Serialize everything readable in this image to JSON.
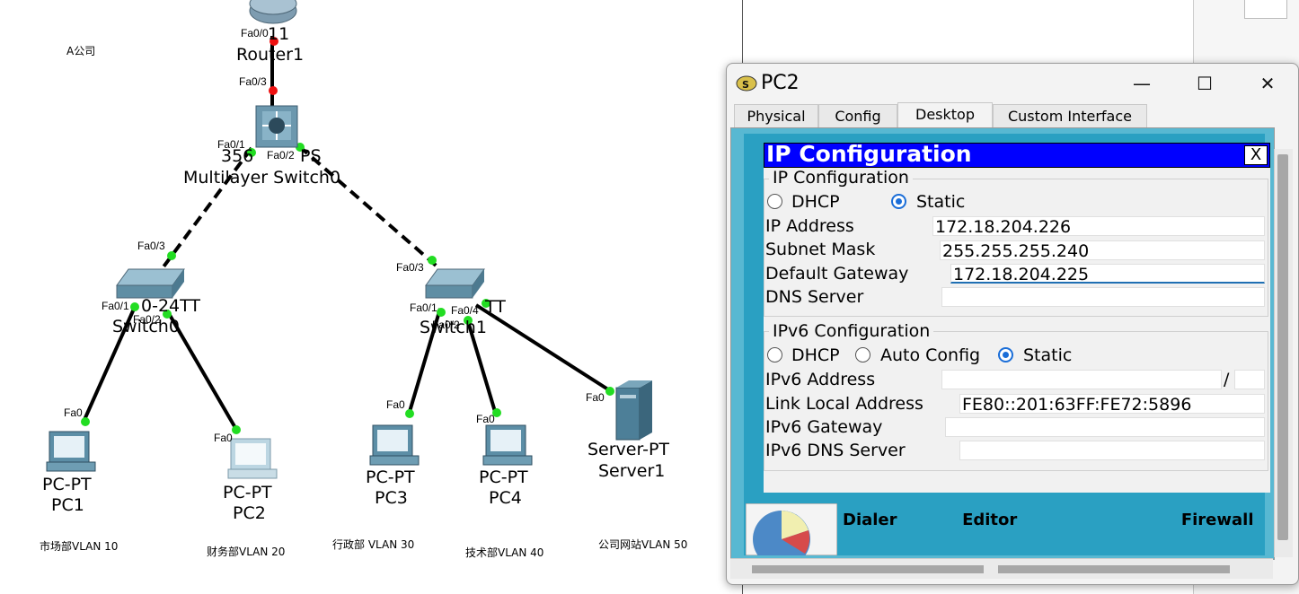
{
  "topology": {
    "company_label": "A公司",
    "router": {
      "model_fragment": "11",
      "name": "Router1"
    },
    "multilayer_switch": {
      "model_fragment": "356",
      "model_suffix": "PS",
      "name": "Multilayer Switch0"
    },
    "switch0": {
      "model_fragment": "0-24TT",
      "name": "Switch0"
    },
    "switch1": {
      "model_fragment": "TT",
      "name": "Switch1"
    },
    "ports": {
      "r_fa00": "Fa0/0",
      "r_fa03": "Fa0/3",
      "ms_fa01": "Fa0/1",
      "ms_fa02": "Fa0/2",
      "s0_fa03": "Fa0/3",
      "s0_fa01": "Fa0/1",
      "s0_fa02": "Fa0/2",
      "s1_fa03": "Fa0/3",
      "s1_fa01": "Fa0/1",
      "s1_fa04": "Fa0/4",
      "s1_fa02": "Fa0/2",
      "pc1_fa0": "Fa0",
      "pc2_fa0": "Fa0",
      "pc3_fa0": "Fa0",
      "pc4_fa0": "Fa0",
      "srv_fa0": "Fa0"
    },
    "devices": [
      {
        "type": "PC-PT",
        "name": "PC1",
        "vlan": "市场部VLAN 10"
      },
      {
        "type": "PC-PT",
        "name": "PC2",
        "vlan": "财务部VLAN 20"
      },
      {
        "type": "PC-PT",
        "name": "PC3",
        "vlan": "行政部 VLAN 30"
      },
      {
        "type": "PC-PT",
        "name": "PC4",
        "vlan": "技术部VLAN 40"
      },
      {
        "type": "Server-PT",
        "name": "Server1",
        "vlan": "公司网站VLAN 50"
      }
    ],
    "link_colors": {
      "up": "#22dd22",
      "down": "#ee1111",
      "wire": "#000000"
    }
  },
  "window": {
    "title": "PC2",
    "controls": {
      "minimize": "—",
      "maximize": "☐",
      "close": "✕"
    },
    "tabs": [
      "Physical",
      "Config",
      "Desktop",
      "Custom Interface"
    ],
    "active_tab": "Desktop",
    "desktop_bottom_labels": [
      "Dialer",
      "Editor",
      "Firewall"
    ]
  },
  "ip_config": {
    "title": "IP Configuration",
    "close_label": "X",
    "ipv4": {
      "group_title": "IP Configuration",
      "dhcp_label": "DHCP",
      "static_label": "Static",
      "mode": "Static",
      "ip_label": "IP Address",
      "ip_value": "172.18.204.226",
      "mask_label": "Subnet Mask",
      "mask_value": "255.255.255.240",
      "gateway_label": "Default Gateway",
      "gateway_value": "172.18.204.225",
      "dns_label": "DNS Server",
      "dns_value": ""
    },
    "ipv6": {
      "group_title": "IPv6 Configuration",
      "dhcp_label": "DHCP",
      "auto_label": "Auto Config",
      "static_label": "Static",
      "mode": "Static",
      "addr_label": "IPv6 Address",
      "addr_value": "",
      "prefix_sep": "/",
      "prefix_value": "",
      "linklocal_label": "Link Local Address",
      "linklocal_value": "FE80::201:63FF:FE72:5896",
      "gateway_label": "IPv6 Gateway",
      "gateway_value": "",
      "dns_label": "IPv6 DNS Server",
      "dns_value": ""
    }
  }
}
